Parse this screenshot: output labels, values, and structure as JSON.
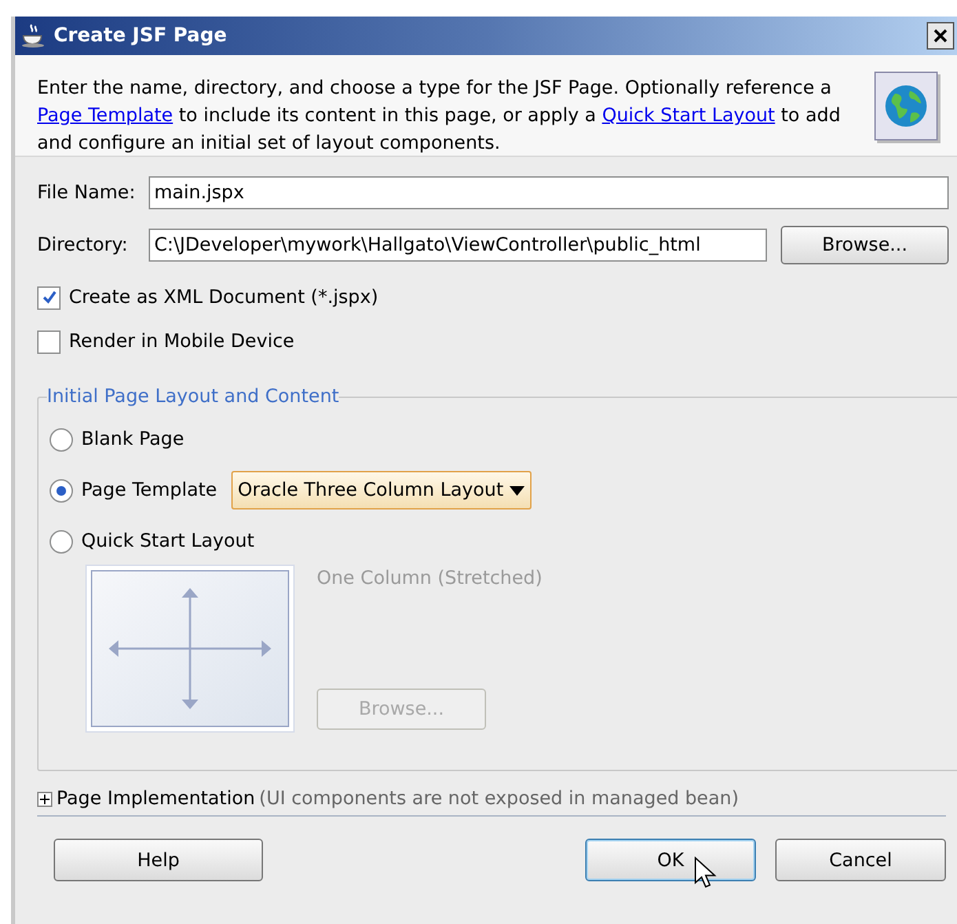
{
  "window": {
    "title": "Create JSF Page"
  },
  "header": {
    "description": [
      {
        "kind": "text",
        "text": "Enter the name, directory, and choose a type for the JSF Page. Optionally reference a "
      },
      {
        "kind": "link",
        "text": "Page Template"
      },
      {
        "kind": "text",
        "text": " to include its content in this page, or apply a "
      },
      {
        "kind": "link",
        "text": "Quick Start Layout"
      },
      {
        "kind": "text",
        "text": " to add and configure an initial set of layout components."
      }
    ]
  },
  "fields": [
    {
      "label": "File Name:",
      "value": "main.jspx"
    },
    {
      "label": "Directory:",
      "value": "C:\\JDeveloper\\mywork\\Hallgato\\ViewController\\public_html",
      "button": "Browse..."
    }
  ],
  "checkboxes": [
    {
      "label": "Create as XML Document (*.jspx)",
      "checked": true
    },
    {
      "label": "Render in Mobile Device",
      "checked": false
    }
  ],
  "layout_group": {
    "title": "Initial Page Layout and Content",
    "options": [
      {
        "label": "Blank Page",
        "selected": false
      },
      {
        "label": "Page Template",
        "selected": true
      },
      {
        "label": "Quick Start Layout",
        "selected": false
      }
    ],
    "template_dropdown": "Oracle Three Column Layout",
    "quick_start": {
      "layout_name": "One Column (Stretched)",
      "browse_button": "Browse...",
      "disabled": true
    }
  },
  "implementation": {
    "label": "Page Implementation",
    "note": "(UI components are not exposed in managed bean)",
    "expanded": false
  },
  "buttons": [
    {
      "label": "Help",
      "default": false
    },
    {
      "label": "OK",
      "default": true
    },
    {
      "label": "Cancel",
      "default": false
    }
  ]
}
